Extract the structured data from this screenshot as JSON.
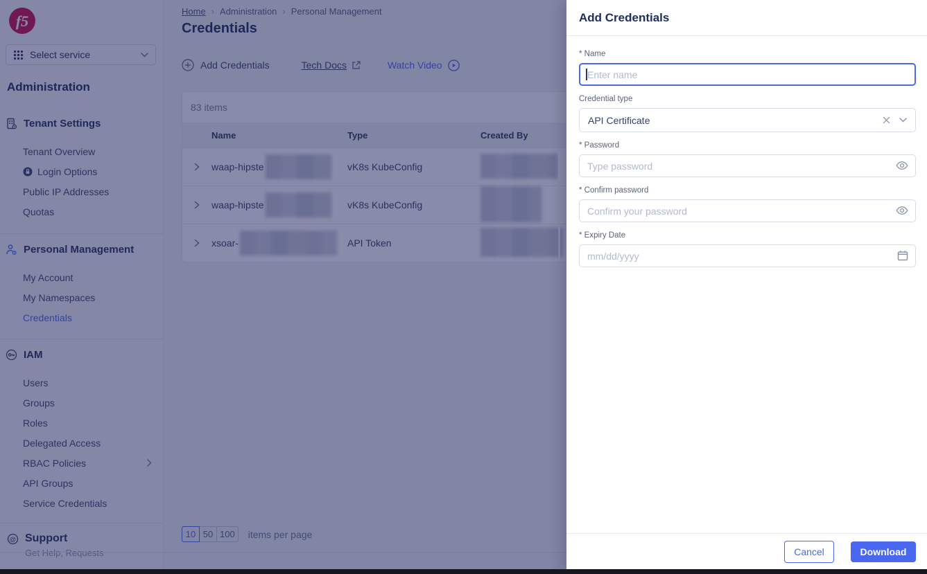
{
  "colors": {
    "accent_blue": "#4A67F0",
    "brand_crimson": "#C8104B",
    "overlay_scrim": "rgba(28,35,90,0.52)",
    "heading_navy": "#1D2C5A",
    "bottom_bar": "#16171E"
  },
  "sidebar": {
    "service_selector_label": "Select service",
    "heading": "Administration",
    "groups": [
      {
        "title": "Tenant Settings",
        "items": [
          {
            "label": "Tenant Overview"
          },
          {
            "label": "Login Options"
          },
          {
            "label": "Public IP Addresses"
          },
          {
            "label": "Quotas"
          }
        ]
      },
      {
        "title": "Personal Management",
        "items": [
          {
            "label": "My Account"
          },
          {
            "label": "My Namespaces"
          },
          {
            "label": "Credentials",
            "active": true
          }
        ]
      },
      {
        "title": "IAM",
        "items": [
          {
            "label": "Users"
          },
          {
            "label": "Groups"
          },
          {
            "label": "Roles"
          },
          {
            "label": "Delegated Access"
          },
          {
            "label": "RBAC Policies",
            "has_submenu": true
          },
          {
            "label": "API Groups"
          },
          {
            "label": "Service Credentials"
          }
        ]
      }
    ],
    "support": {
      "title": "Support",
      "subtitle": "Get Help, Requests"
    }
  },
  "main": {
    "breadcrumb": {
      "items": [
        "Home",
        "Administration",
        "Personal Management"
      ]
    },
    "page_title": "Credentials",
    "toolbar": {
      "add_label": "Add Credentials",
      "tech_docs_label": "Tech Docs",
      "watch_video_label": "Watch Video"
    },
    "table": {
      "count_label": "83 items",
      "columns": [
        "Name",
        "Type",
        "Created By"
      ],
      "rows": [
        {
          "name_prefix": "waap-hipste",
          "type": "vK8s KubeConfig",
          "created_by": "(redacted)"
        },
        {
          "name_prefix": "waap-hipste",
          "type": "vK8s KubeConfig",
          "created_by": "(redacted)"
        },
        {
          "name_prefix": "xsoar-",
          "type": "API Token",
          "created_by": "(redacted)"
        }
      ]
    },
    "pagination": {
      "options": [
        "10",
        "50",
        "100"
      ],
      "selected": "10",
      "label": "items per page"
    }
  },
  "drawer": {
    "title": "Add Credentials",
    "name_field": {
      "label": "* Name",
      "placeholder": "Enter name"
    },
    "credential_type_field": {
      "label": "Credential type",
      "value": "API Certificate"
    },
    "password_field": {
      "label": "* Password",
      "placeholder": "Type password"
    },
    "confirm_password_field": {
      "label": "* Confirm password",
      "placeholder": "Confirm your password"
    },
    "expiry_field": {
      "label": "* Expiry Date",
      "placeholder": "mm/dd/yyyy"
    },
    "cancel_label": "Cancel",
    "download_label": "Download"
  }
}
